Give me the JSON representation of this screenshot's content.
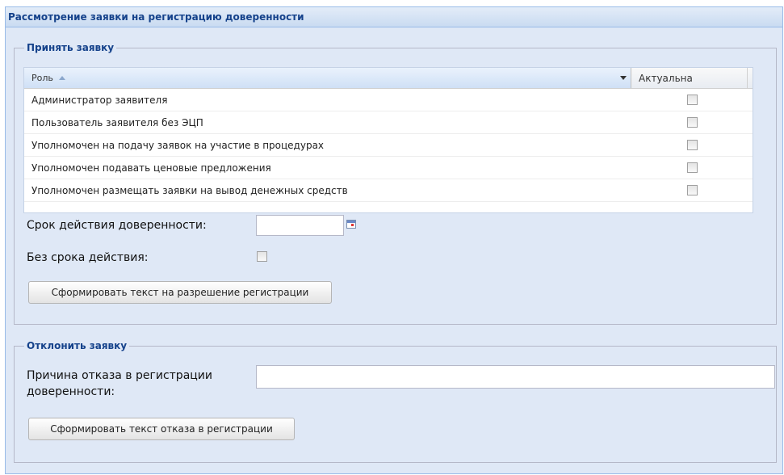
{
  "panel": {
    "title": "Рассмотрение заявки на регистрацию доверенности"
  },
  "accept": {
    "legend": "Принять заявку",
    "grid": {
      "col_role": "Роль",
      "col_active": "Актуальна",
      "rows": [
        {
          "role": "Администратор заявителя",
          "active": false
        },
        {
          "role": "Пользователь заявителя без ЭЦП",
          "active": false
        },
        {
          "role": "Уполномочен на подачу заявок на участие в процедурах",
          "active": false
        },
        {
          "role": "Уполномочен подавать ценовые предложения",
          "active": false
        },
        {
          "role": "Уполномочен размещать заявки на вывод денежных средств",
          "active": false
        }
      ]
    },
    "validity_label": "Срок действия доверенности:",
    "validity_value": "",
    "no_term_label": "Без срока действия:",
    "button": "Сформировать текст на разрешение регистрации"
  },
  "reject": {
    "legend": "Отклонить заявку",
    "reason_label_line1": "Причина отказа в регистрации",
    "reason_label_line2": "доверенности:",
    "reason_value": "",
    "button": "Сформировать текст отказа в регистрации"
  }
}
